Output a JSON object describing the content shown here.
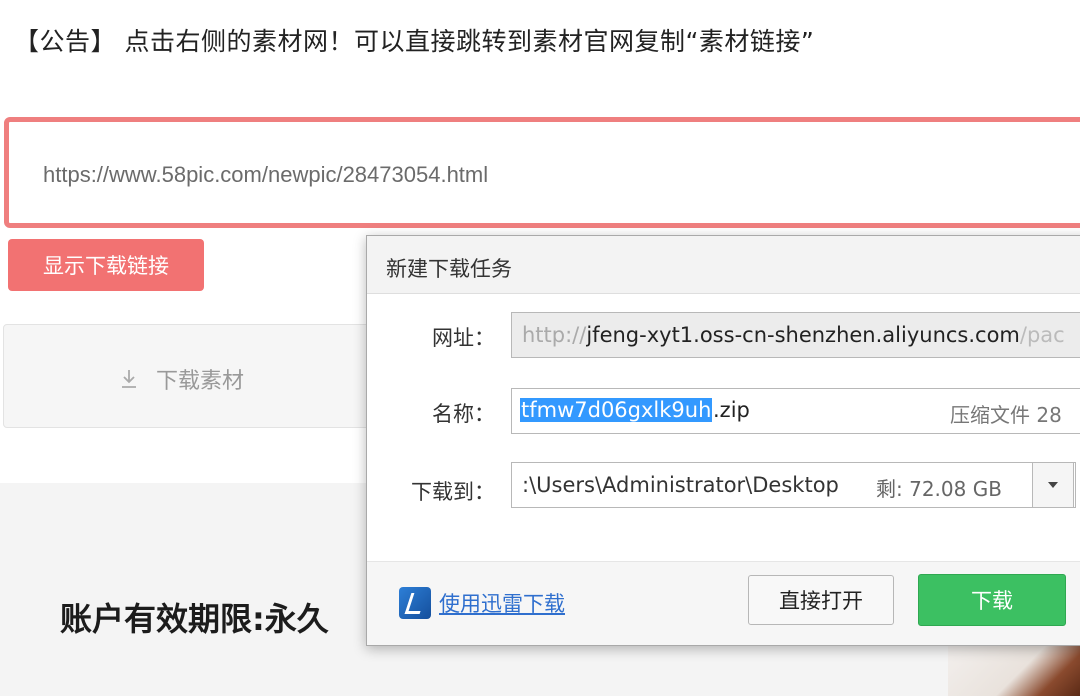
{
  "page": {
    "notice": "【公告】 点击右侧的素材网！可以直接跳转到素材官网复制“素材链接”",
    "url_input_value": "https://www.58pic.com/newpic/28473054.html",
    "show_link_button": "显示下载链接",
    "download_material_button": "下载素材",
    "account_text": "账户有效期限:永久"
  },
  "dialog": {
    "title": "新建下载任务",
    "url_label": "网址：",
    "url_protocol": "http://",
    "url_host": "jfeng-xyt1.oss-cn-shenzhen.aliyuncs.com",
    "url_tail": "/pac",
    "name_label": "名称：",
    "name_selected": "tfmw7d06gxlk9uh",
    "name_ext": ".zip",
    "file_type": "压缩文件 28",
    "save_to_label": "下载到：",
    "save_path": ":\\Users\\Administrator\\Desktop",
    "free_space": "剩: 72.08 GB",
    "thunder_link": "使用迅雷下载",
    "open_button": "直接打开",
    "download_button": "下载"
  },
  "colors": {
    "accent_red": "#ef7f7f",
    "button_red": "#f27272",
    "download_green": "#3cc062",
    "selection_blue": "#3399ff",
    "link_blue": "#2f6fce"
  },
  "icons": {
    "download_arrow": "download-arrow-icon",
    "thunder": "thunder-icon",
    "dropdown": "chevron-down-icon"
  }
}
